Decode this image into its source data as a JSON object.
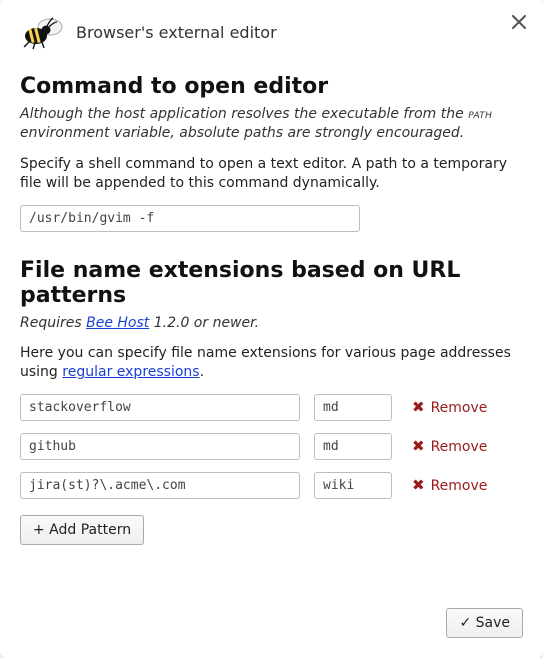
{
  "window": {
    "title": "Browser's external editor"
  },
  "section1": {
    "heading": "Command to open editor",
    "note_pre": "Although the host application resolves the executable from the ",
    "note_code": "path",
    "note_post": " environment variable, absolute paths are strongly encouraged.",
    "desc": "Specify a shell command to open a text editor. A path to a temporary file will be appended to this command dynamically.",
    "command_value": "/usr/bin/gvim -f"
  },
  "section2": {
    "heading": "File name extensions based on URL patterns",
    "requires_pre": "Requires ",
    "requires_link": "Bee Host",
    "requires_post": " 1.2.0 or newer.",
    "desc_pre": "Here you can specify file name extensions for various page addresses using ",
    "desc_link": "regular expressions",
    "desc_post": ".",
    "patterns": [
      {
        "pattern": "stackoverflow",
        "ext": "md"
      },
      {
        "pattern": "github",
        "ext": "md"
      },
      {
        "pattern": "jira(st)?\\.acme\\.com",
        "ext": "wiki"
      }
    ],
    "remove_label": "Remove",
    "add_label": "+ Add Pattern"
  },
  "footer": {
    "save_label": "✓ Save"
  }
}
